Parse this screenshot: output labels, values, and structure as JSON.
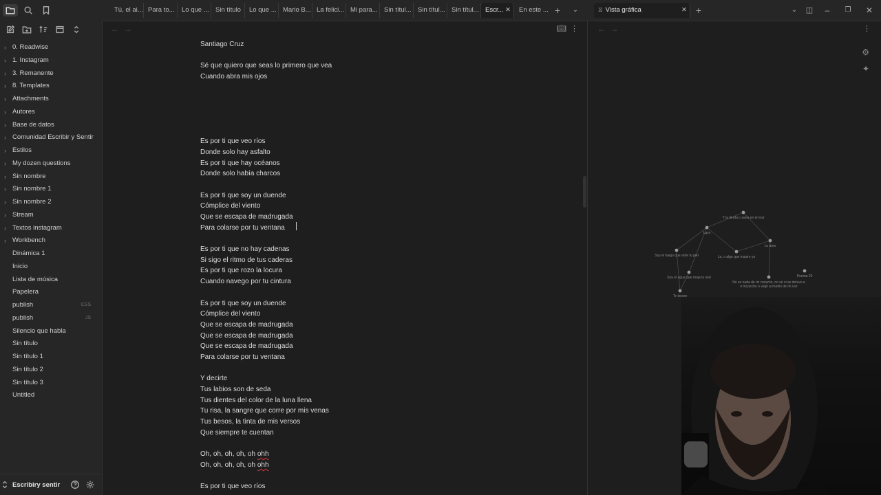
{
  "sidebar": {
    "folders": [
      "0. Readwise",
      "1. Instagram",
      "3. Remanente",
      "8. Templates",
      "Attachments",
      "Autores",
      "Base de datos",
      "Comunidad Escribir y Sentir",
      "Estilos",
      "My dozen questions",
      "Sin nombre",
      "Sin nombre 1",
      "Sin nombre 2",
      "Stream",
      "Textos instagram",
      "Workbench"
    ],
    "files": [
      {
        "name": "Dinámica 1",
        "ext": ""
      },
      {
        "name": "Inicio",
        "ext": ""
      },
      {
        "name": "Lista de música",
        "ext": ""
      },
      {
        "name": "Papelera",
        "ext": ""
      },
      {
        "name": "publish",
        "ext": "CSS"
      },
      {
        "name": "publish",
        "ext": "JS"
      },
      {
        "name": "Silencio que habla",
        "ext": ""
      },
      {
        "name": "Sin título",
        "ext": ""
      },
      {
        "name": "Sin título 1",
        "ext": ""
      },
      {
        "name": "Sin título 2",
        "ext": ""
      },
      {
        "name": "Sin título 3",
        "ext": ""
      },
      {
        "name": "Untitled",
        "ext": ""
      }
    ],
    "vault_name": "Escribiry sentir"
  },
  "tabs": [
    "Tú, el ai...",
    "Para to...",
    "Lo que ...",
    "Sin título",
    "Lo que ...",
    "Mario B...",
    "La felici...",
    "Mi para...",
    "Sin títul...",
    "Sin títul...",
    "Sin títul...",
    "Escr...",
    "En este ..."
  ],
  "graph_tab": "Vista gráfica",
  "note": {
    "lines": [
      "Santiago Cruz",
      "",
      "Sé que quiero que seas lo primero que vea",
      "Cuando abra mis ojos",
      "",
      "",
      "",
      "",
      "",
      "Es por ti que veo ríos",
      "Donde solo hay asfalto",
      "Es por ti que hay océanos",
      "Donde solo había charcos",
      "",
      "Es por ti que soy un duende",
      "Cómplice del viento",
      "Que se escapa de madrugada",
      "Para colarse por tu ventana",
      "",
      "Es por ti que no hay cadenas",
      "Si sigo el ritmo de tus caderas",
      "Es por ti que rozo la locura",
      "Cuando navego por tu cintura",
      "",
      "Es por ti que soy un duende",
      "Cómplice del viento",
      "Que se escapa de madrugada",
      "Que se escapa de madrugada",
      "Que se escapa de madrugada",
      "Para colarse por tu ventana",
      "",
      "Y decirte",
      "Tus labios son de seda",
      "Tus dientes del color de la luna llena",
      "Tu risa, la sangre que corre por mis venas",
      "Tus besos, la tinta de mis versos",
      "Que siempre te cuentan",
      "",
      "Oh, oh, oh, oh, oh ohh",
      "Oh, oh, oh, oh, oh ohh",
      "",
      "Es por ti que veo ríos"
    ],
    "spell_word": "ohh"
  },
  "graph": {
    "nodes": [
      {
        "id": "n1",
        "label": "Y la tierda o sana en el mar"
      },
      {
        "id": "n2",
        "label": "Layo"
      },
      {
        "id": "n3",
        "label": "Lo amo"
      },
      {
        "id": "n4",
        "label": "Soy el fuego que arde tu piel"
      },
      {
        "id": "n5",
        "label": "La, o algo que inspiro yo"
      },
      {
        "id": "n6",
        "label": "Soy el agua que moja tu sed"
      },
      {
        "id": "n7",
        "label": "Poema 20"
      },
      {
        "id": "n8",
        "label": "No se nada de mi corazón, no sé si se detuvo en mi pecho o viajó al medio de mi voz"
      },
      {
        "id": "n9",
        "label": "Te deseo"
      }
    ]
  }
}
